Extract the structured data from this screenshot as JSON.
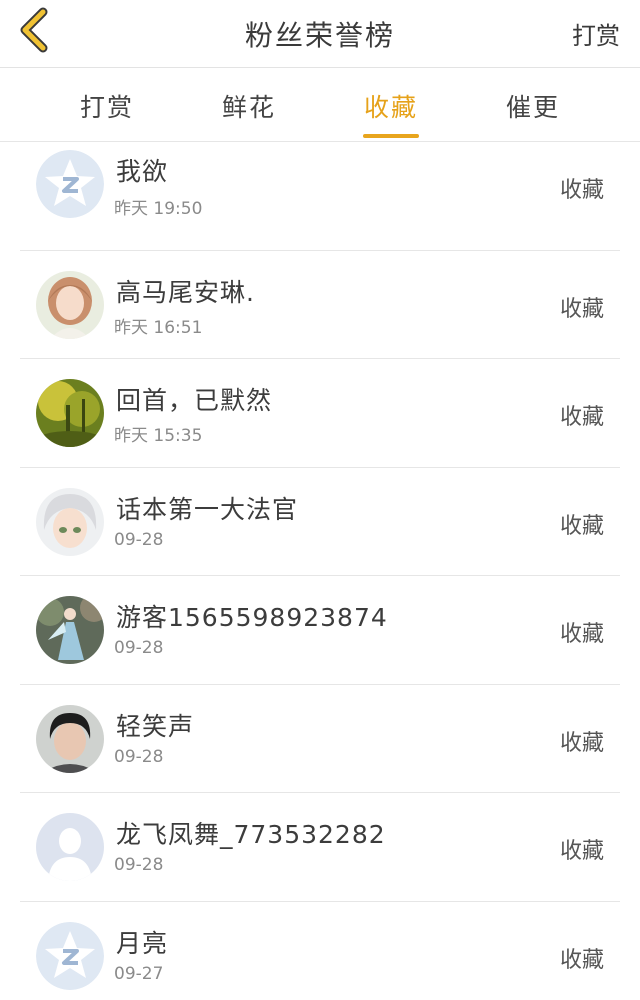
{
  "header": {
    "title": "粉丝荣誉榜",
    "action_label": "打赏"
  },
  "tabs": [
    {
      "label": "打赏"
    },
    {
      "label": "鲜花"
    },
    {
      "label": "收藏"
    },
    {
      "label": "催更"
    }
  ],
  "active_tab": "收藏",
  "list": [
    {
      "name": "我欲",
      "time": "昨天 19:50",
      "type": "收藏",
      "avatar": "default-qq-avatar"
    },
    {
      "name": "高马尾安琳.",
      "time": "昨天 16:51",
      "type": "收藏",
      "avatar": "girl-portrait-avatar"
    },
    {
      "name": "回首，已默然",
      "time": "昨天 15:35",
      "type": "收藏",
      "avatar": "forest-photo-avatar"
    },
    {
      "name": "话本第一大法官",
      "time": "09-28",
      "type": "收藏",
      "avatar": "anime-white-hair-avatar"
    },
    {
      "name": "游客1565598923874",
      "time": "09-28",
      "type": "收藏",
      "avatar": "hanfu-girl-avatar"
    },
    {
      "name": "轻笑声",
      "time": "09-28",
      "type": "收藏",
      "avatar": "man-portrait-avatar"
    },
    {
      "name": "龙飞凤舞_773532282",
      "time": "09-28",
      "type": "收藏",
      "avatar": "blank-person-avatar"
    },
    {
      "name": "月亮",
      "time": "09-27",
      "type": "收藏",
      "avatar": "default-qq-avatar"
    }
  ],
  "colors": {
    "accent": "#e8a51d",
    "back_icon": "#e8b62a",
    "divider": "#e6e6e6"
  }
}
